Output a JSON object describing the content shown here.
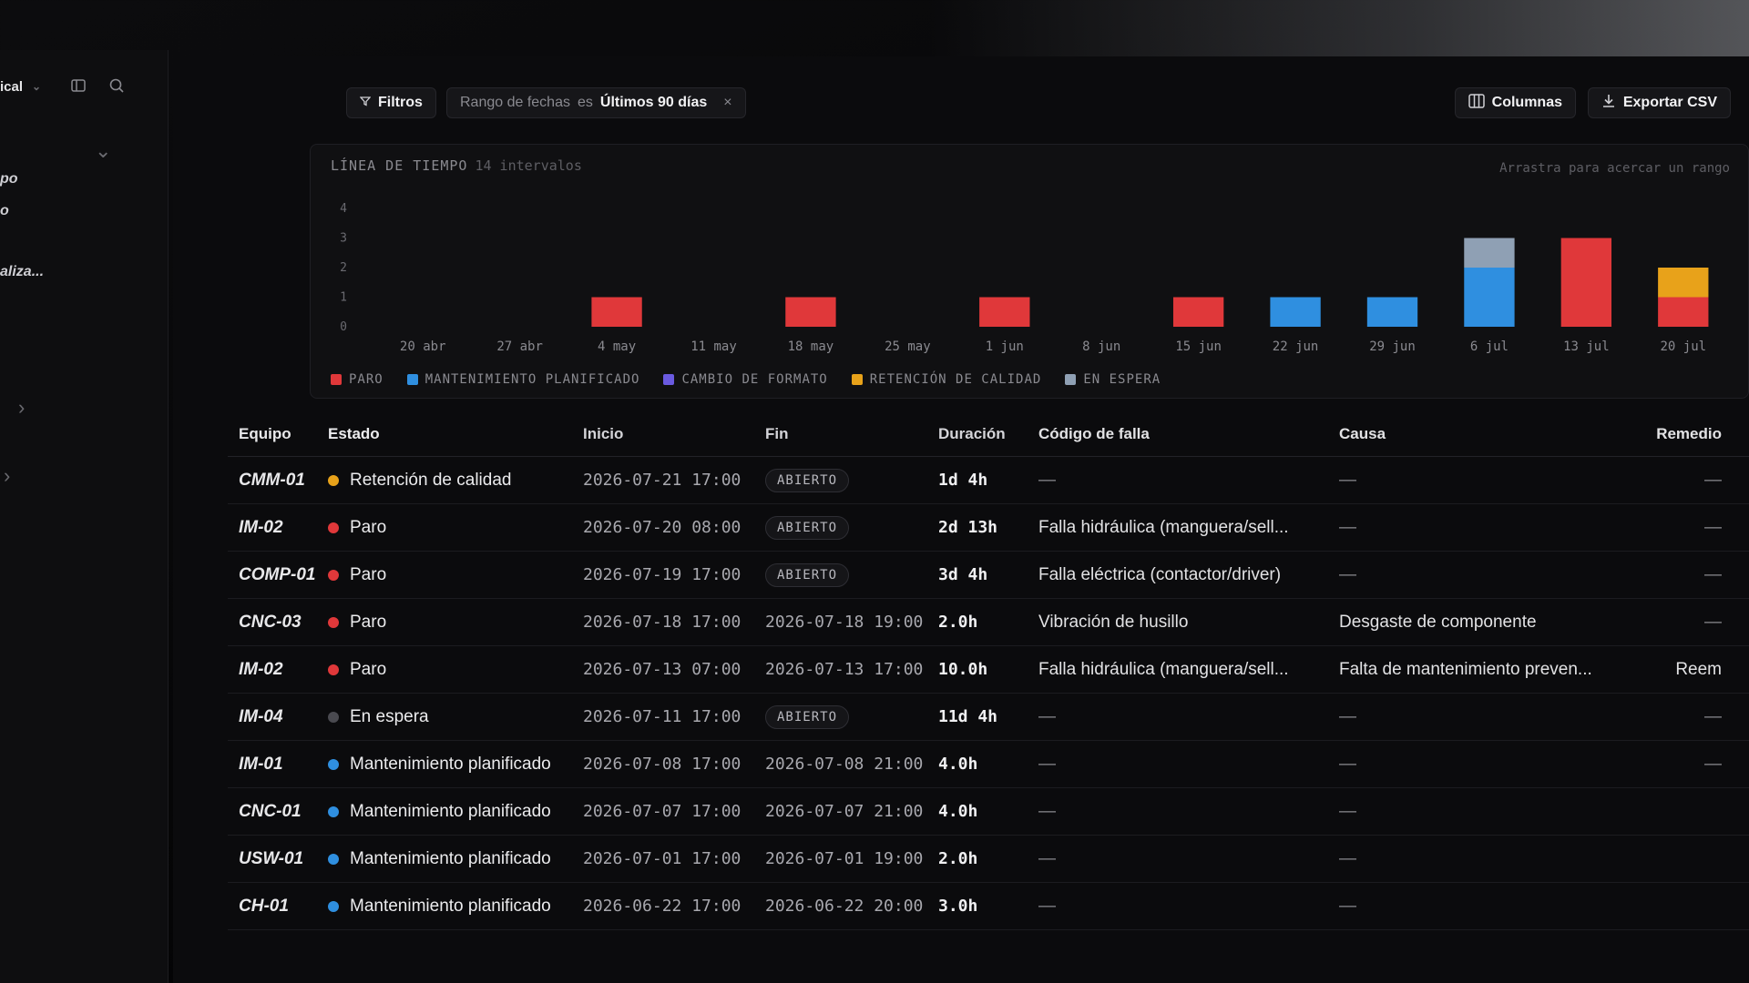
{
  "sidebar": {
    "workspace_label": "ical",
    "items": [
      "po",
      "o",
      "aliza..."
    ]
  },
  "toolbar": {
    "filters_label": "Filtros",
    "range_field": "Rango de fechas",
    "range_op": "es",
    "range_value": "Últimos 90 días",
    "columns_label": "Columnas",
    "export_label": "Exportar CSV"
  },
  "chart_data": {
    "type": "bar",
    "title": "LÍNEA DE TIEMPO",
    "subtitle": "14 intervalos",
    "hint": "Arrastra para acercar un rango",
    "categories": [
      "20 abr",
      "27 abr",
      "4 may",
      "11 may",
      "18 may",
      "25 may",
      "1 jun",
      "8 jun",
      "15 jun",
      "22 jun",
      "29 jun",
      "6 jul",
      "13 jul",
      "20 jul"
    ],
    "ylim": [
      0,
      4
    ],
    "yticks": [
      0,
      1,
      2,
      3,
      4
    ],
    "stacked": true,
    "series": [
      {
        "name": "PARO",
        "color": "#e0383a",
        "values": [
          0,
          0,
          1,
          0,
          1,
          0,
          1,
          0,
          1,
          0,
          0,
          0,
          3,
          1
        ]
      },
      {
        "name": "MANTENIMIENTO PLANIFICADO",
        "color": "#2f8fe0",
        "values": [
          0,
          0,
          0,
          0,
          0,
          0,
          0,
          0,
          0,
          1,
          1,
          2,
          0,
          0
        ]
      },
      {
        "name": "CAMBIO DE FORMATO",
        "color": "#6a5ae0",
        "values": [
          0,
          0,
          0,
          0,
          0,
          0,
          0,
          0,
          0,
          0,
          0,
          0,
          0,
          0
        ]
      },
      {
        "name": "RETENCIÓN DE CALIDAD",
        "color": "#e8a21a",
        "values": [
          0,
          0,
          0,
          0,
          0,
          0,
          0,
          0,
          0,
          0,
          0,
          0,
          0,
          1
        ]
      },
      {
        "name": "EN ESPERA",
        "color": "#8fa0b4",
        "values": [
          0,
          0,
          0,
          0,
          0,
          0,
          0,
          0,
          0,
          0,
          0,
          1,
          0,
          0
        ]
      }
    ]
  },
  "table": {
    "headers": [
      "Equipo",
      "Estado",
      "Inicio",
      "Fin",
      "Duración",
      "Código de falla",
      "Causa",
      "Remedio"
    ],
    "rows": [
      {
        "equipo": "CMM-01",
        "estado": "Retención de calidad",
        "color": "#e8a21a",
        "inicio": "2026-07-21 17:00",
        "fin": "ABIERTO",
        "duracion": "1d 4h",
        "codigo": "—",
        "causa": "—",
        "remedio": "—"
      },
      {
        "equipo": "IM-02",
        "estado": "Paro",
        "color": "#e0383a",
        "inicio": "2026-07-20 08:00",
        "fin": "ABIERTO",
        "duracion": "2d 13h",
        "codigo": "Falla hidráulica (manguera/sell...",
        "causa": "—",
        "remedio": "—"
      },
      {
        "equipo": "COMP-01",
        "estado": "Paro",
        "color": "#e0383a",
        "inicio": "2026-07-19 17:00",
        "fin": "ABIERTO",
        "duracion": "3d 4h",
        "codigo": "Falla eléctrica (contactor/driver)",
        "causa": "—",
        "remedio": "—"
      },
      {
        "equipo": "CNC-03",
        "estado": "Paro",
        "color": "#e0383a",
        "inicio": "2026-07-18 17:00",
        "fin": "2026-07-18 19:00",
        "duracion": "2.0h",
        "codigo": "Vibración de husillo",
        "causa": "Desgaste de componente",
        "remedio": "—"
      },
      {
        "equipo": "IM-02",
        "estado": "Paro",
        "color": "#e0383a",
        "inicio": "2026-07-13 07:00",
        "fin": "2026-07-13 17:00",
        "duracion": "10.0h",
        "codigo": "Falla hidráulica (manguera/sell...",
        "causa": "Falta de mantenimiento preven...",
        "remedio": "Reem"
      },
      {
        "equipo": "IM-04",
        "estado": "En espera",
        "color": "#4a4a50",
        "inicio": "2026-07-11 17:00",
        "fin": "ABIERTO",
        "duracion": "11d 4h",
        "codigo": "—",
        "causa": "—",
        "remedio": "—"
      },
      {
        "equipo": "IM-01",
        "estado": "Mantenimiento planificado",
        "color": "#2f8fe0",
        "inicio": "2026-07-08 17:00",
        "fin": "2026-07-08 21:00",
        "duracion": "4.0h",
        "codigo": "—",
        "causa": "—",
        "remedio": "—"
      },
      {
        "equipo": "CNC-01",
        "estado": "Mantenimiento planificado",
        "color": "#2f8fe0",
        "inicio": "2026-07-07 17:00",
        "fin": "2026-07-07 21:00",
        "duracion": "4.0h",
        "codigo": "—",
        "causa": "—",
        "remedio": ""
      },
      {
        "equipo": "USW-01",
        "estado": "Mantenimiento planificado",
        "color": "#2f8fe0",
        "inicio": "2026-07-01 17:00",
        "fin": "2026-07-01 19:00",
        "duracion": "2.0h",
        "codigo": "—",
        "causa": "—",
        "remedio": ""
      },
      {
        "equipo": "CH-01",
        "estado": "Mantenimiento planificado",
        "color": "#2f8fe0",
        "inicio": "2026-06-22 17:00",
        "fin": "2026-06-22 20:00",
        "duracion": "3.0h",
        "codigo": "—",
        "causa": "—",
        "remedio": ""
      }
    ]
  }
}
